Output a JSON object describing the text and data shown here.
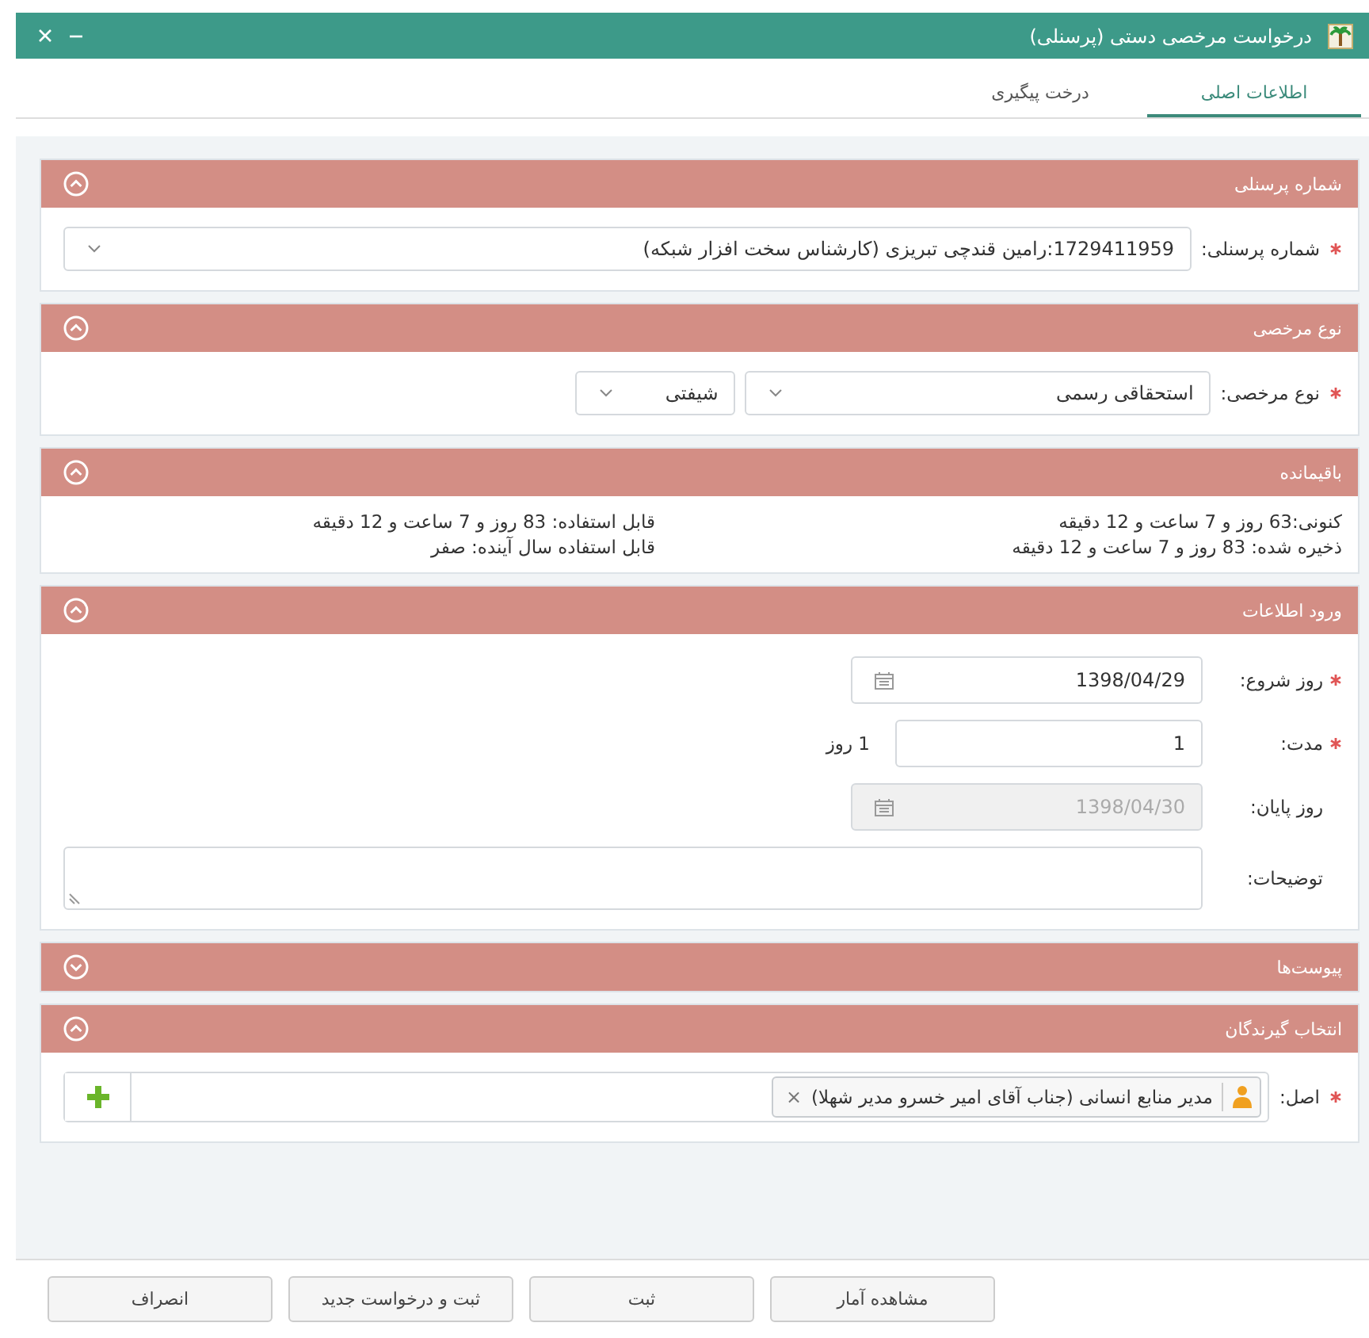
{
  "window": {
    "title": "درخواست مرخصی دستی (پرسنلی)"
  },
  "tabs": [
    {
      "label": "اطلاعات اصلی",
      "selected": true
    },
    {
      "label": "درخت پیگیری",
      "selected": false
    }
  ],
  "sections": [
    {
      "kind": "personnel",
      "title": "شماره پرسنلی",
      "expanded": true,
      "label": "شماره پرسنلی:",
      "required": true,
      "value": "1729411959:رامین قندچی تبریزی (کارشناس سخت افزار شبکه)"
    },
    {
      "kind": "leave_type",
      "title": "نوع مرخصی",
      "expanded": true,
      "label": "نوع مرخصی:",
      "required": true,
      "value": "استحقاقی رسمی",
      "value_2": "شیفتی"
    },
    {
      "kind": "balance",
      "title": "باقیمانده",
      "expanded": true,
      "columns": [
        [
          "کنونی:63 روز و 7 ساعت و 12 دقیقه",
          "ذخیره شده: 83 روز و 7 ساعت و 12 دقیقه"
        ],
        [
          "قابل استفاده: 83 روز و 7 ساعت و 12 دقیقه",
          "قابل استفاده سال آینده: صفر"
        ]
      ]
    },
    {
      "kind": "entry",
      "title": "ورود اطلاعات",
      "expanded": true,
      "fields": [
        {
          "kind": "date",
          "label": "روز شروع:",
          "required": true,
          "value": "1398/04/29",
          "disabled": false
        },
        {
          "kind": "number",
          "label": "مدت:",
          "required": true,
          "value": "1",
          "unit": "1 روز",
          "disabled": false
        },
        {
          "kind": "date",
          "label": "روز پایان:",
          "required": false,
          "value": "1398/04/30",
          "disabled": true
        },
        {
          "kind": "textarea",
          "label": "توضیحات:",
          "required": false
        }
      ]
    },
    {
      "kind": "attachments",
      "title": "پیوست‌ها",
      "expanded": false
    },
    {
      "kind": "recipients",
      "title": "انتخاب گیرندگان",
      "expanded": true,
      "label": "اصل:",
      "required": true,
      "tokens": [
        {
          "text": "مدیر منابع انسانی (جناب آقای امیر خسرو مدیر شهلا)",
          "remove": "×"
        }
      ]
    }
  ],
  "buttons": [
    "مشاهده آمار",
    "ثبت",
    "ثبت و درخواست جدید",
    "انصراف"
  ]
}
